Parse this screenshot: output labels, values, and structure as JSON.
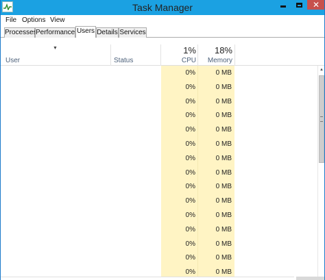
{
  "window": {
    "title": "Task Manager",
    "title_bar_color": "#1ba1e2",
    "close_button_color": "#c7514d",
    "minimize_icon": "minimize-icon",
    "maximize_icon": "maximize-icon",
    "close_icon": "close-icon",
    "close_glyph": "✕"
  },
  "menu": {
    "items": [
      "File",
      "Options",
      "View"
    ]
  },
  "tabs": [
    {
      "label": "Processes",
      "active": false
    },
    {
      "label": "Performance",
      "active": false
    },
    {
      "label": "Users",
      "active": true
    },
    {
      "label": "Details",
      "active": false
    },
    {
      "label": "Services",
      "active": false
    }
  ],
  "table": {
    "sort_indicator": "▼",
    "columns": {
      "user": "User",
      "status": "Status",
      "cpu": {
        "total": "1%",
        "label": "CPU"
      },
      "memory": {
        "total": "18%",
        "label": "Memory"
      }
    },
    "highlight_color": "#fff4c4",
    "rows": [
      {
        "cpu": "0%",
        "memory": "0 MB"
      },
      {
        "cpu": "0%",
        "memory": "0 MB"
      },
      {
        "cpu": "0%",
        "memory": "0 MB"
      },
      {
        "cpu": "0%",
        "memory": "0 MB"
      },
      {
        "cpu": "0%",
        "memory": "0 MB"
      },
      {
        "cpu": "0%",
        "memory": "0 MB"
      },
      {
        "cpu": "0%",
        "memory": "0 MB"
      },
      {
        "cpu": "0%",
        "memory": "0 MB"
      },
      {
        "cpu": "0%",
        "memory": "0 MB"
      },
      {
        "cpu": "0%",
        "memory": "0 MB"
      },
      {
        "cpu": "0%",
        "memory": "0 MB"
      },
      {
        "cpu": "0%",
        "memory": "0 MB"
      },
      {
        "cpu": "0%",
        "memory": "0 MB"
      },
      {
        "cpu": "0%",
        "memory": "0 MB"
      },
      {
        "cpu": "0%",
        "memory": "0 MB"
      }
    ]
  },
  "scrollbar": {
    "up_arrow": "▲"
  }
}
